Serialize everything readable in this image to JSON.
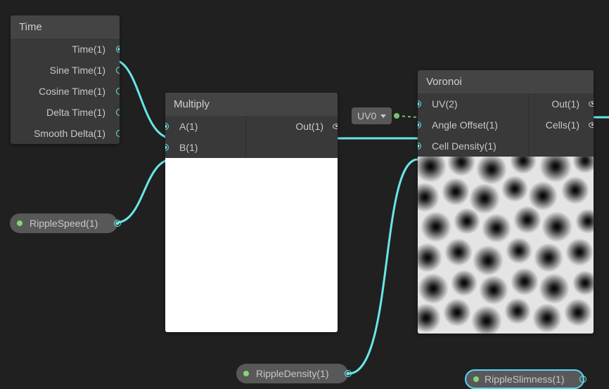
{
  "time_node": {
    "title": "Time",
    "ports": [
      "Time(1)",
      "Sine Time(1)",
      "Cosine Time(1)",
      "Delta Time(1)",
      "Smooth Delta(1)"
    ]
  },
  "multiply_node": {
    "title": "Multiply",
    "in": [
      "A(1)",
      "B(1)"
    ],
    "out": "Out(1)"
  },
  "voronoi_node": {
    "title": "Voronoi",
    "in": [
      "UV(2)",
      "Angle Offset(1)",
      "Cell Density(1)"
    ],
    "out": [
      "Out(1)",
      "Cells(1)"
    ]
  },
  "uv_dropdown": "UV0",
  "prop_speed": "RippleSpeed(1)",
  "prop_density": "RippleDensity(1)",
  "prop_slimness": "RippleSlimness(1)"
}
